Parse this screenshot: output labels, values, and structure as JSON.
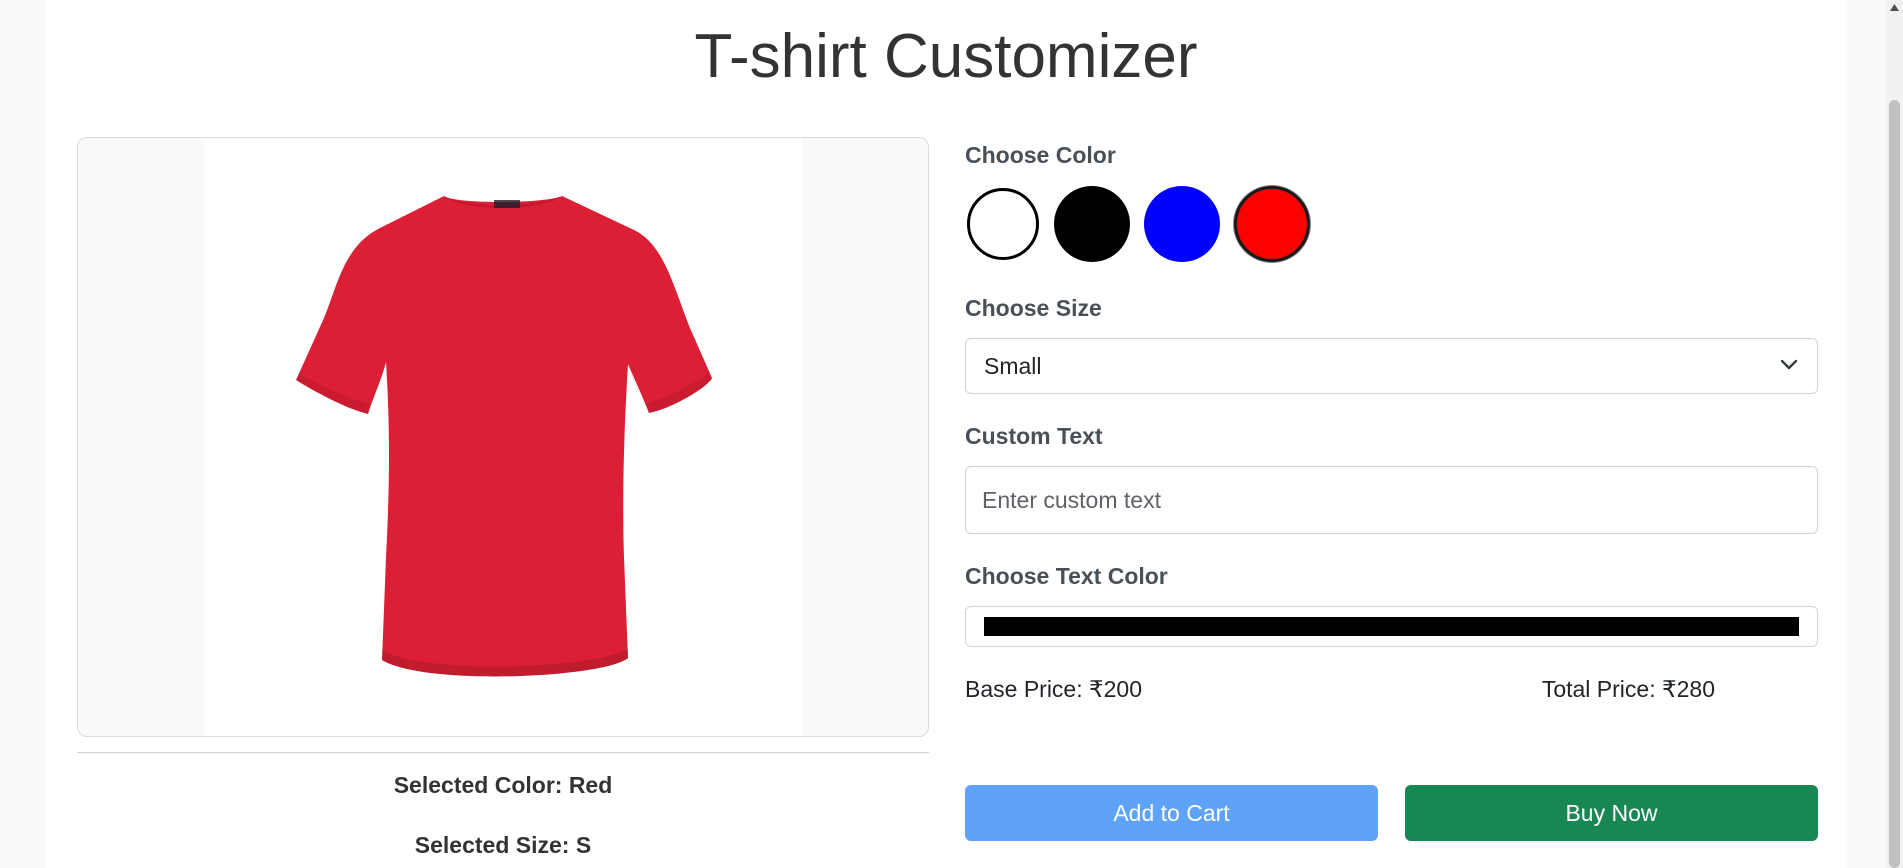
{
  "page": {
    "title": "T-shirt Customizer"
  },
  "preview": {
    "shirt_color": "#dc1f35",
    "selected_color_text": "Selected Color: Red",
    "selected_size_text": "Selected Size: S"
  },
  "color_section": {
    "label": "Choose Color",
    "swatches": [
      {
        "name": "White",
        "hex": "#ffffff"
      },
      {
        "name": "Black",
        "hex": "#000000"
      },
      {
        "name": "Blue",
        "hex": "#0000ff"
      },
      {
        "name": "Red",
        "hex": "#ff0000",
        "selected": true
      }
    ]
  },
  "size_section": {
    "label": "Choose Size",
    "selected": "Small"
  },
  "custom_text_section": {
    "label": "Custom Text",
    "placeholder": "Enter custom text",
    "value": ""
  },
  "text_color_section": {
    "label": "Choose Text Color",
    "value": "#000000"
  },
  "pricing": {
    "base": "Base Price: ₹200",
    "total": "Total Price: ₹280"
  },
  "actions": {
    "add_to_cart": "Add to Cart",
    "buy_now": "Buy Now"
  }
}
